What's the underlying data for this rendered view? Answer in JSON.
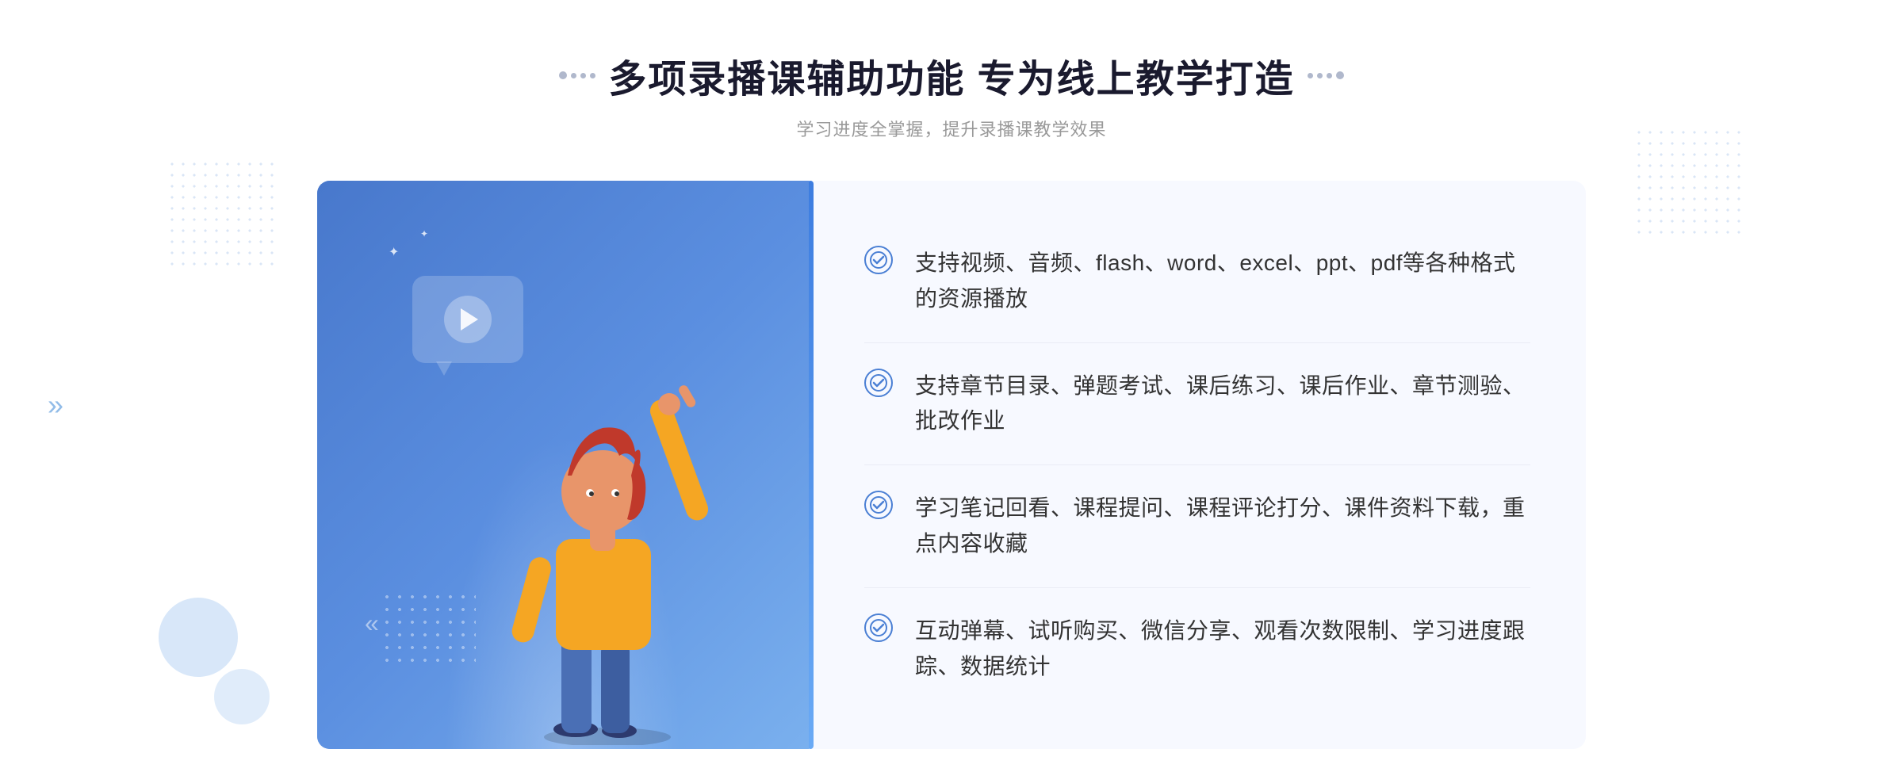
{
  "header": {
    "title": "多项录播课辅助功能 专为线上教学打造",
    "subtitle": "学习进度全掌握，提升录播课教学效果"
  },
  "features": [
    {
      "id": 1,
      "text": "支持视频、音频、flash、word、excel、ppt、pdf等各种格式的资源播放"
    },
    {
      "id": 2,
      "text": "支持章节目录、弹题考试、课后练习、课后作业、章节测验、批改作业"
    },
    {
      "id": 3,
      "text": "学习笔记回看、课程提问、课程评论打分、课件资料下载，重点内容收藏"
    },
    {
      "id": 4,
      "text": "互动弹幕、试听购买、微信分享、观看次数限制、学习进度跟踪、数据统计"
    }
  ],
  "illustration": {
    "play_label": "播放"
  },
  "decorative": {
    "arrow": "»",
    "sparkle": "✦"
  }
}
